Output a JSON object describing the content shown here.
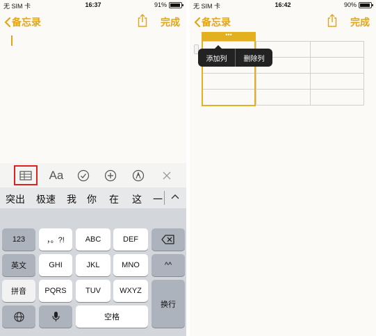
{
  "left": {
    "status": {
      "carrier": "无 SIM 卡",
      "time": "16:37",
      "battery": "91%",
      "battery_level": 0.91
    },
    "nav": {
      "back_label": "备忘录",
      "done_label": "完成"
    },
    "toolbar": {
      "icons": [
        "table-icon",
        "format-icon",
        "checklist-icon",
        "add-icon",
        "markup-icon",
        "close-icon"
      ],
      "format_label": "Aa",
      "highlight_color": "#e02020"
    },
    "candidates": [
      "突出",
      "极速",
      "我",
      "你",
      "在",
      "这",
      "一"
    ],
    "keyboard": {
      "row1": [
        "123",
        "，。?!",
        "ABC",
        "DEF"
      ],
      "row2": [
        "英文",
        "GHI",
        "JKL",
        "MNO",
        "^^"
      ],
      "row3": [
        "拼音",
        "PQRS",
        "TUV",
        "WXYZ"
      ],
      "row4": [
        "space_label"
      ],
      "space": "空格",
      "return": "换行"
    }
  },
  "right": {
    "status": {
      "carrier": "无 SIM 卡",
      "time": "16:42",
      "battery": "90%",
      "battery_level": 0.9
    },
    "nav": {
      "back_label": "备忘录",
      "done_label": "完成"
    },
    "table": {
      "rows": 4,
      "cols": 3,
      "selected_col": 1,
      "handle_dots": "•••"
    },
    "popup": {
      "add_col": "添加列",
      "delete_col": "删除列"
    }
  },
  "colors": {
    "accent": "#e3a516",
    "keyboard_bg": "#d3d6db"
  }
}
